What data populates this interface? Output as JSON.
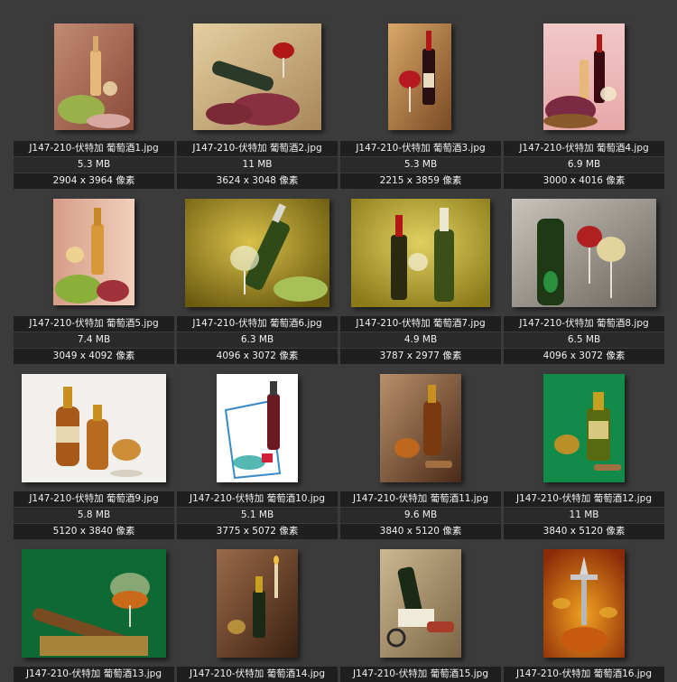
{
  "gallery": {
    "items": [
      {
        "filename": "J147-210-伏特加 葡萄酒1.jpg",
        "size": "5.3 MB",
        "dims": "2904 x 3964 像素"
      },
      {
        "filename": "J147-210-伏特加 葡萄酒2.jpg",
        "size": "11 MB",
        "dims": "3624 x 3048 像素"
      },
      {
        "filename": "J147-210-伏特加 葡萄酒3.jpg",
        "size": "5.3 MB",
        "dims": "2215 x 3859 像素"
      },
      {
        "filename": "J147-210-伏特加 葡萄酒4.jpg",
        "size": "6.9 MB",
        "dims": "3000 x 4016 像素"
      },
      {
        "filename": "J147-210-伏特加 葡萄酒5.jpg",
        "size": "7.4 MB",
        "dims": "3049 x 4092 像素"
      },
      {
        "filename": "J147-210-伏特加 葡萄酒6.jpg",
        "size": "6.3 MB",
        "dims": "4096 x 3072 像素"
      },
      {
        "filename": "J147-210-伏特加 葡萄酒7.jpg",
        "size": "4.9 MB",
        "dims": "3787 x 2977 像素"
      },
      {
        "filename": "J147-210-伏特加 葡萄酒8.jpg",
        "size": "6.5 MB",
        "dims": "4096 x 3072 像素"
      },
      {
        "filename": "J147-210-伏特加 葡萄酒9.jpg",
        "size": "5.8 MB",
        "dims": "5120 x 3840 像素"
      },
      {
        "filename": "J147-210-伏特加 葡萄酒10.jpg",
        "size": "5.1 MB",
        "dims": "3775 x 5072 像素"
      },
      {
        "filename": "J147-210-伏特加 葡萄酒11.jpg",
        "size": "9.6 MB",
        "dims": "3840 x 5120 像素"
      },
      {
        "filename": "J147-210-伏特加 葡萄酒12.jpg",
        "size": "11 MB",
        "dims": "3840 x 5120 像素"
      },
      {
        "filename": "J147-210-伏特加 葡萄酒13.jpg",
        "size": "",
        "dims": ""
      },
      {
        "filename": "J147-210-伏特加 葡萄酒14.jpg",
        "size": "",
        "dims": ""
      },
      {
        "filename": "J147-210-伏特加 葡萄酒15.jpg",
        "size": "",
        "dims": ""
      },
      {
        "filename": "J147-210-伏特加 葡萄酒16.jpg",
        "size": "",
        "dims": ""
      }
    ]
  }
}
